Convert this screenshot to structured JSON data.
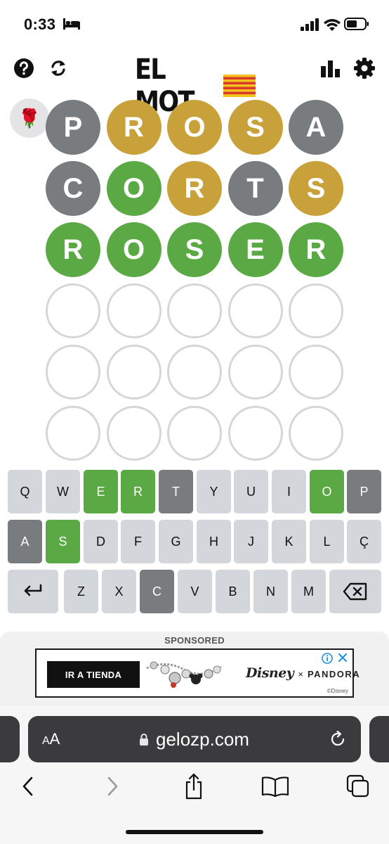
{
  "status": {
    "time": "0:33"
  },
  "header": {
    "title": "EL MOT",
    "help_icon": "help-circle-icon",
    "refresh_icon": "refresh-icon",
    "stats_icon": "bar-chart-icon",
    "settings_icon": "gear-icon",
    "flag_icon": "catalan-flag-icon"
  },
  "badge": {
    "emoji": "🌹"
  },
  "colors": {
    "correct": "#5aa944",
    "present": "#c9a13a",
    "absent": "#787c7e",
    "key": "#d3d6da",
    "empty_border": "#d6d6d6"
  },
  "board": {
    "rows": [
      {
        "letters": [
          "P",
          "R",
          "O",
          "S",
          "A"
        ],
        "states": [
          "absent",
          "present",
          "present",
          "present",
          "absent"
        ]
      },
      {
        "letters": [
          "C",
          "O",
          "R",
          "T",
          "S"
        ],
        "states": [
          "absent",
          "correct",
          "present",
          "absent",
          "present"
        ]
      },
      {
        "letters": [
          "R",
          "O",
          "S",
          "E",
          "R"
        ],
        "states": [
          "correct",
          "correct",
          "correct",
          "correct",
          "correct"
        ]
      },
      {
        "letters": [
          "",
          "",
          "",
          "",
          ""
        ],
        "states": [
          "empty",
          "empty",
          "empty",
          "empty",
          "empty"
        ]
      },
      {
        "letters": [
          "",
          "",
          "",
          "",
          ""
        ],
        "states": [
          "empty",
          "empty",
          "empty",
          "empty",
          "empty"
        ]
      },
      {
        "letters": [
          "",
          "",
          "",
          "",
          ""
        ],
        "states": [
          "empty",
          "empty",
          "empty",
          "empty",
          "empty"
        ]
      }
    ]
  },
  "keyboard": {
    "rows": [
      [
        {
          "label": "Q",
          "state": "default"
        },
        {
          "label": "W",
          "state": "default"
        },
        {
          "label": "E",
          "state": "correct"
        },
        {
          "label": "R",
          "state": "correct"
        },
        {
          "label": "T",
          "state": "absent"
        },
        {
          "label": "Y",
          "state": "default"
        },
        {
          "label": "U",
          "state": "default"
        },
        {
          "label": "I",
          "state": "default"
        },
        {
          "label": "O",
          "state": "correct"
        },
        {
          "label": "P",
          "state": "absent"
        }
      ],
      [
        {
          "label": "A",
          "state": "absent"
        },
        {
          "label": "S",
          "state": "correct"
        },
        {
          "label": "D",
          "state": "default"
        },
        {
          "label": "F",
          "state": "default"
        },
        {
          "label": "G",
          "state": "default"
        },
        {
          "label": "H",
          "state": "default"
        },
        {
          "label": "J",
          "state": "default"
        },
        {
          "label": "K",
          "state": "default"
        },
        {
          "label": "L",
          "state": "default"
        },
        {
          "label": "Ç",
          "state": "default"
        }
      ],
      [
        {
          "label": "",
          "icon": "enter-icon",
          "state": "default"
        },
        {
          "label": "Z",
          "state": "default"
        },
        {
          "label": "X",
          "state": "default"
        },
        {
          "label": "C",
          "state": "absent"
        },
        {
          "label": "V",
          "state": "default"
        },
        {
          "label": "B",
          "state": "default"
        },
        {
          "label": "N",
          "state": "default"
        },
        {
          "label": "M",
          "state": "default"
        },
        {
          "label": "",
          "icon": "backspace-icon",
          "state": "default"
        }
      ]
    ]
  },
  "ad": {
    "sponsored_label": "SPONSORED",
    "cta": "IR A TIENDA",
    "brand_disney": "Disney",
    "brand_x": "×",
    "brand_pandora": "PANDORA",
    "copyright": "©Disney",
    "info_icon": "info-icon",
    "close_icon": "close-icon"
  },
  "browser": {
    "aa_small": "A",
    "aa_large": "A",
    "url": "gelozp.com",
    "lock_icon": "lock-icon",
    "reload_icon": "reload-icon",
    "nav_icons": [
      "back-icon",
      "forward-icon",
      "share-icon",
      "bookmarks-icon",
      "tabs-icon"
    ]
  }
}
